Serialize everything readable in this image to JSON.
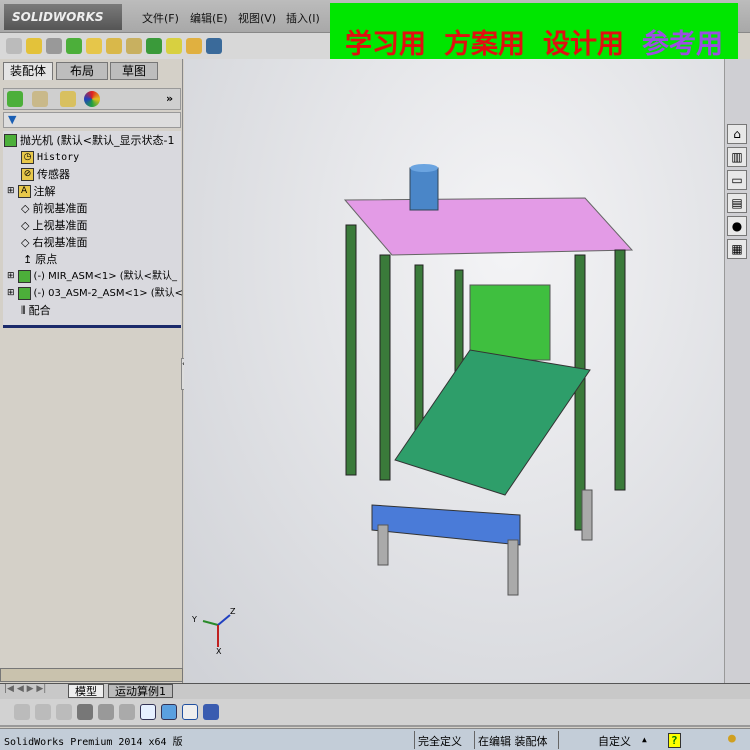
{
  "app": {
    "logo": "SOLIDWORKS",
    "menu": [
      "文件(F)",
      "编辑(E)",
      "视图(V)",
      "插入(I)"
    ]
  },
  "banner": {
    "items": [
      {
        "text": "学习用",
        "color": "#e01010"
      },
      {
        "text": "方案用",
        "color": "#e01010"
      },
      {
        "text": "设计用",
        "color": "#e01010"
      },
      {
        "text": "参考用",
        "color": "#9b4fe0"
      }
    ]
  },
  "panel": {
    "tabs": [
      "装配体",
      "布局",
      "草图"
    ],
    "more": "»"
  },
  "tree": {
    "root": "抛光机  (默认<默认_显示状态-1",
    "items": [
      {
        "label": "History",
        "icon": "history-folder-icon"
      },
      {
        "label": "传感器",
        "icon": "sensor-folder-icon"
      },
      {
        "label": "注解",
        "icon": "annotation-folder-icon",
        "expand": "+"
      },
      {
        "label": "前视基准面",
        "icon": "plane-icon"
      },
      {
        "label": "上视基准面",
        "icon": "plane-icon"
      },
      {
        "label": "右视基准面",
        "icon": "plane-icon"
      },
      {
        "label": "原点",
        "icon": "origin-icon"
      },
      {
        "label": "(-) MIR_ASM<1> (默认<默认_",
        "icon": "assembly-icon",
        "expand": "+"
      },
      {
        "label": "(-) 03_ASM-2_ASM<1> (默认<",
        "icon": "assembly-icon",
        "expand": "+"
      },
      {
        "label": "配合",
        "icon": "mates-icon"
      }
    ]
  },
  "triad": {
    "x": "X",
    "y": "Y",
    "z": "Z"
  },
  "bottom_tabs": [
    "模型",
    "运动算例1"
  ],
  "status": {
    "product": "SolidWorks Premium 2014 x64 版",
    "state": "完全定义",
    "editing": "在编辑 装配体",
    "custom": "自定义",
    "custom_arrow": "▲",
    "help": "?"
  },
  "colors": {
    "banner_bg": "#00e600",
    "frame": "#3a7a3a",
    "top_plate": "#e39be6",
    "belt": "#2e9e6a",
    "base_plate": "#4a7bd8"
  }
}
